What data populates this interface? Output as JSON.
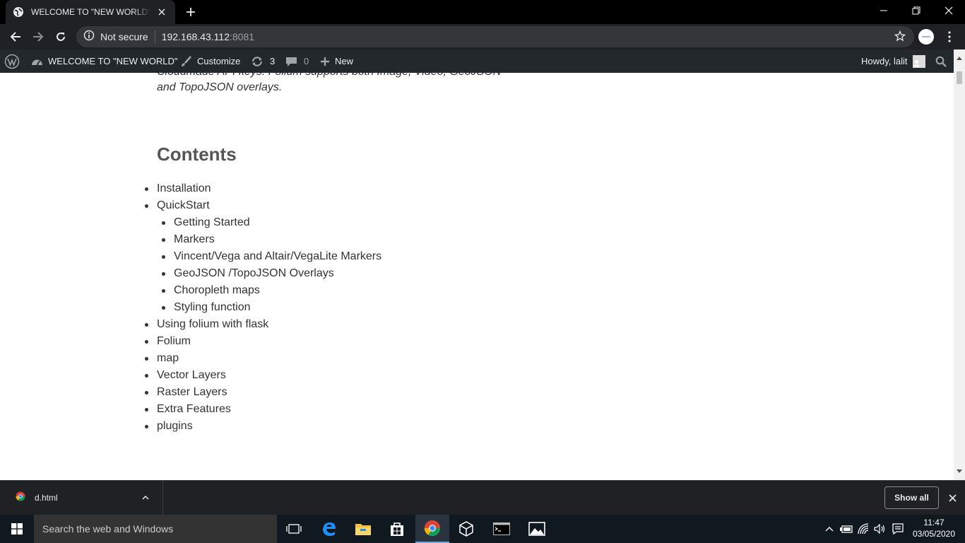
{
  "browser": {
    "tab_title": "WELCOME TO \"NEW WORLD\" – J",
    "security_label": "Not secure",
    "url_host": "192.168.43.112",
    "url_port": ":8081"
  },
  "adminbar": {
    "site_name": "WELCOME TO \"NEW WORLD\"",
    "customize": "Customize",
    "updates_count": "3",
    "comments_count": "0",
    "new_label": "New",
    "howdy": "Howdy, lalit"
  },
  "article": {
    "intro_line1": "Cloudmade API keys. Folium supports both Image, Video, GeoJSON",
    "intro_line2": "and TopoJSON overlays.",
    "contents_heading": "Contents",
    "toc": [
      {
        "label": "Installation",
        "level": 1
      },
      {
        "label": "QuickStart",
        "level": 1
      },
      {
        "label": "Getting Started",
        "level": 2
      },
      {
        "label": "Markers",
        "level": 2
      },
      {
        "label": "Vincent/Vega and Altair/VegaLite Markers",
        "level": 2
      },
      {
        "label": "GeoJSON /TopoJSON Overlays",
        "level": 2
      },
      {
        "label": "Choropleth maps",
        "level": 2
      },
      {
        "label": "Styling function",
        "level": 2
      },
      {
        "label": "Using folium with flask",
        "level": 1
      },
      {
        "label": "Folium",
        "level": 1
      },
      {
        "label": "map",
        "level": 1
      },
      {
        "label": "Vector Layers",
        "level": 1
      },
      {
        "label": "Raster Layers",
        "level": 1
      },
      {
        "label": "Extra Features",
        "level": 1
      },
      {
        "label": "plugins",
        "level": 1
      }
    ]
  },
  "downloads": {
    "file_name": "d.html",
    "show_all": "Show all"
  },
  "taskbar": {
    "search_placeholder": "Search the web and Windows",
    "time": "11:47",
    "date": "03/05/2020"
  },
  "colors": {
    "chrome_dark": "#202124",
    "adminbar": "#23282d",
    "taskbar": "#101820"
  }
}
